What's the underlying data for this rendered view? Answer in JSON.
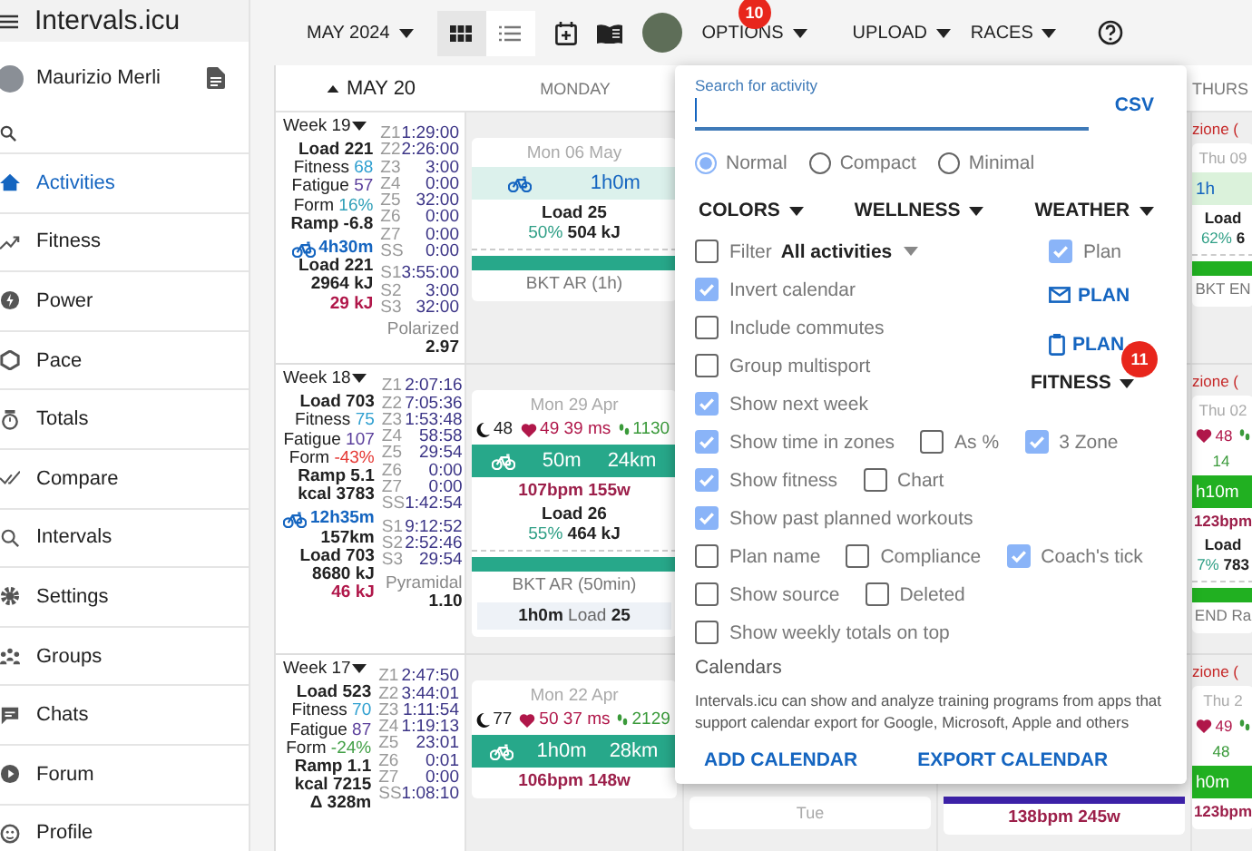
{
  "sidebar": {
    "app_title": "Intervals.icu",
    "user_name": "Maurizio Merli",
    "items": [
      {
        "label": "Activities",
        "selected": true
      },
      {
        "label": "Fitness",
        "selected": false
      },
      {
        "label": "Power",
        "selected": false
      },
      {
        "label": "Pace",
        "selected": false
      },
      {
        "label": "Totals",
        "selected": false
      },
      {
        "label": "Compare",
        "selected": false
      },
      {
        "label": "Intervals",
        "selected": false
      },
      {
        "label": "Settings",
        "selected": false
      },
      {
        "label": "Groups",
        "selected": false
      },
      {
        "label": "Chats",
        "selected": false
      },
      {
        "label": "Forum",
        "selected": false
      },
      {
        "label": "Profile",
        "selected": false
      }
    ]
  },
  "toolbar": {
    "month": "MAY 2024",
    "views": [
      {
        "kind": "grid",
        "selected": true
      },
      {
        "kind": "list",
        "selected": false
      }
    ],
    "options": {
      "label": "OPTIONS",
      "badge": "10"
    },
    "menus": [
      {
        "label": "UPLOAD"
      },
      {
        "label": "RACES"
      }
    ]
  },
  "calendar": {
    "range_label": "MAY 20",
    "monday_header": "MONDAY",
    "thursday_header": "THURS",
    "weeks": [
      {
        "label": "Week 19",
        "summary": {
          "lines": [
            {
              "kind": "plain",
              "label": "Load",
              "value": "221"
            },
            {
              "kind": "fitness",
              "label": "Fitness",
              "value": "68"
            },
            {
              "kind": "fatigue",
              "label": "Fatigue",
              "value": "57"
            },
            {
              "kind": "form",
              "label": "Form",
              "value": "16%",
              "color": "#2f9fb8"
            },
            {
              "kind": "plain",
              "label": "Ramp",
              "value": "-6.8"
            },
            {
              "kind": "ride",
              "value": "4h30m"
            },
            {
              "kind": "plain",
              "label": "Load",
              "value": "221"
            },
            {
              "kind": "plain",
              "value": "2964 kJ"
            },
            {
              "kind": "warn",
              "value": "29 kJ"
            }
          ],
          "zones": [
            {
              "zone": "Z1",
              "time": "1:29:00"
            },
            {
              "zone": "Z2",
              "time": "2:26:00"
            },
            {
              "zone": "Z3",
              "time": "3:00"
            },
            {
              "zone": "Z4",
              "time": "0:00"
            },
            {
              "zone": "Z5",
              "time": "32:00"
            },
            {
              "zone": "Z6",
              "time": "0:00"
            },
            {
              "zone": "Z7",
              "time": "0:00"
            },
            {
              "zone": "SS",
              "time": "0:00"
            },
            {
              "zone": "S1",
              "time": "3:55:00"
            },
            {
              "zone": "S2",
              "time": "3:00"
            },
            {
              "zone": "S3",
              "time": "32:00"
            }
          ],
          "model": "Polarized",
          "index": "2.97"
        },
        "monday": {
          "date": "Mon 06 May",
          "activity": {
            "kind": "planned",
            "color": "#27a88a",
            "duration": "1h0m",
            "load": "Load 25",
            "percent": "50%",
            "energy": "504 kJ",
            "name": "BKT AR (1h)"
          }
        },
        "thursday": {
          "event": "zione (",
          "date": "Thu 09",
          "activity": {
            "kind": "planned",
            "color": "#21b021",
            "duration": "1h",
            "load": "Load",
            "percent": "62%",
            "energy": "6",
            "name": "BKT EN"
          }
        }
      },
      {
        "label": "Week 18",
        "summary": {
          "lines": [
            {
              "kind": "plain",
              "label": "Load",
              "value": "703"
            },
            {
              "kind": "fitness",
              "label": "Fitness",
              "value": "75"
            },
            {
              "kind": "fatigue",
              "label": "Fatigue",
              "value": "107"
            },
            {
              "kind": "form",
              "label": "Form",
              "value": "-43%",
              "color": "#e53935"
            },
            {
              "kind": "plain",
              "label": "Ramp",
              "value": "5.1"
            },
            {
              "kind": "plain",
              "label": "kcal",
              "value": "3783"
            },
            {
              "kind": "ride",
              "value": "12h35m"
            },
            {
              "kind": "plain",
              "value": "157km"
            },
            {
              "kind": "plain",
              "label": "Load",
              "value": "703"
            },
            {
              "kind": "plain",
              "value": "8680 kJ"
            },
            {
              "kind": "warn",
              "value": "46 kJ"
            }
          ],
          "zones": [
            {
              "zone": "Z1",
              "time": "2:07:16"
            },
            {
              "zone": "Z2",
              "time": "7:05:36"
            },
            {
              "zone": "Z3",
              "time": "1:53:48"
            },
            {
              "zone": "Z4",
              "time": "58:58"
            },
            {
              "zone": "Z5",
              "time": "29:54"
            },
            {
              "zone": "Z6",
              "time": "0:00"
            },
            {
              "zone": "Z7",
              "time": "0:00"
            },
            {
              "zone": "SS",
              "time": "1:42:54"
            },
            {
              "zone": "S1",
              "time": "9:12:52"
            },
            {
              "zone": "S2",
              "time": "2:52:46"
            },
            {
              "zone": "S3",
              "time": "29:54"
            }
          ],
          "model": "Pyramidal",
          "index": "1.10"
        },
        "monday": {
          "date": "Mon 29 Apr",
          "wellness": {
            "sleep": "48",
            "hrv": "49 39 ms",
            "steps": "1130"
          },
          "activity": {
            "kind": "completed",
            "color": "#27a88a",
            "duration": "50m",
            "distance": "24km",
            "power": "107bpm 155w",
            "load": "Load 26",
            "percent": "55%",
            "energy": "464 kJ",
            "name": "BKT AR (50min)"
          },
          "planned": {
            "duration": "1h0m",
            "label": "Load",
            "load": "25"
          }
        },
        "thursday": {
          "event": "zione (",
          "date": "Thu 02",
          "wellness": {
            "hrv": "48",
            "steps": "14"
          },
          "activity": {
            "kind": "completed",
            "color": "#21b021",
            "duration": "h10m",
            "power": "123bpm",
            "load": "Load",
            "percent": "7%",
            "energy": "783",
            "name": "END Ra"
          }
        }
      },
      {
        "label": "Week 17",
        "summary": {
          "lines": [
            {
              "kind": "plain",
              "label": "Load",
              "value": "523"
            },
            {
              "kind": "fitness",
              "label": "Fitness",
              "value": "70"
            },
            {
              "kind": "fatigue",
              "label": "Fatigue",
              "value": "87"
            },
            {
              "kind": "form",
              "label": "Form",
              "value": "-24%",
              "color": "#43a047"
            },
            {
              "kind": "plain",
              "label": "Ramp",
              "value": "1.1"
            },
            {
              "kind": "plain",
              "label": "kcal",
              "value": "7215"
            },
            {
              "kind": "plain",
              "value": "Δ 328m"
            }
          ],
          "zones": [
            {
              "zone": "Z1",
              "time": "2:47:50"
            },
            {
              "zone": "Z2",
              "time": "3:44:01"
            },
            {
              "zone": "Z3",
              "time": "1:11:54"
            },
            {
              "zone": "Z4",
              "time": "1:19:13"
            },
            {
              "zone": "Z5",
              "time": "23:01"
            },
            {
              "zone": "Z6",
              "time": "0:01"
            },
            {
              "zone": "Z7",
              "time": "0:00"
            },
            {
              "zone": "SS",
              "time": "1:08:10"
            }
          ]
        },
        "monday": {
          "date": "Mon 22 Apr",
          "wellness": {
            "sleep": "77",
            "hrv": "50 37 ms",
            "steps": "2129"
          },
          "activity": {
            "kind": "completed",
            "color": "#27a88a",
            "duration": "1h0m",
            "distance": "28km",
            "power": "106bpm 148w"
          }
        },
        "tuesday": {
          "date": "Tue"
        },
        "wednesday": {
          "activity": {
            "color": "#3d22a8",
            "power": "138bpm 245w"
          }
        },
        "thursday": {
          "event": "zione (",
          "date": "Thu 2",
          "wellness": {
            "hrv": "49",
            "steps": "48"
          },
          "activity": {
            "kind": "completed",
            "color": "#21b021",
            "duration": "h0m",
            "power": "123bpm"
          }
        }
      }
    ]
  },
  "options": {
    "search": {
      "label": "Search for activity"
    },
    "export": "CSV",
    "display_modes": [
      {
        "label": "Normal",
        "selected": true
      },
      {
        "label": "Compact",
        "selected": false
      },
      {
        "label": "Minimal",
        "selected": false
      }
    ],
    "menus": [
      {
        "label": "COLORS"
      },
      {
        "label": "WELLNESS"
      },
      {
        "label": "WEATHER"
      }
    ],
    "filter": {
      "label": "Filter",
      "checked": false,
      "value": "All activities"
    },
    "left_checks": [
      {
        "label": "Invert calendar",
        "checked": true
      },
      {
        "label": "Include commutes",
        "checked": false
      },
      {
        "label": "Group multisport",
        "checked": false
      },
      {
        "label": "Show next week",
        "checked": true
      }
    ],
    "plan": {
      "label": "Plan",
      "checked": true
    },
    "plan_actions": [
      {
        "label": "PLAN",
        "kind": "email"
      },
      {
        "label": "PLAN",
        "kind": "clipboard"
      }
    ],
    "fitness_menu": {
      "label": "FITNESS",
      "badge": "11"
    },
    "check_rows": [
      {
        "items": [
          {
            "label": "Show time in zones",
            "checked": true
          },
          {
            "label": "As %",
            "checked": false
          },
          {
            "label": "3 Zone",
            "checked": true
          }
        ]
      },
      {
        "items": [
          {
            "label": "Show fitness",
            "checked": true
          },
          {
            "label": "Chart",
            "checked": false
          }
        ]
      },
      {
        "items": [
          {
            "label": "Show past planned workouts",
            "checked": true
          }
        ]
      },
      {
        "items": [
          {
            "label": "Plan name",
            "checked": false
          },
          {
            "label": "Compliance",
            "checked": false
          },
          {
            "label": "Coach's tick",
            "checked": true
          }
        ]
      },
      {
        "items": [
          {
            "label": "Show source",
            "checked": false
          },
          {
            "label": "Deleted",
            "checked": false
          }
        ]
      },
      {
        "items": [
          {
            "label": "Show weekly totals on top",
            "checked": false
          }
        ]
      }
    ],
    "calendars": {
      "heading": "Calendars",
      "description": "Intervals.icu can show and analyze training programs from apps that support calendar export for Google, Microsoft, Apple and others",
      "actions": [
        "ADD CALENDAR",
        "EXPORT CALENDAR"
      ]
    }
  }
}
